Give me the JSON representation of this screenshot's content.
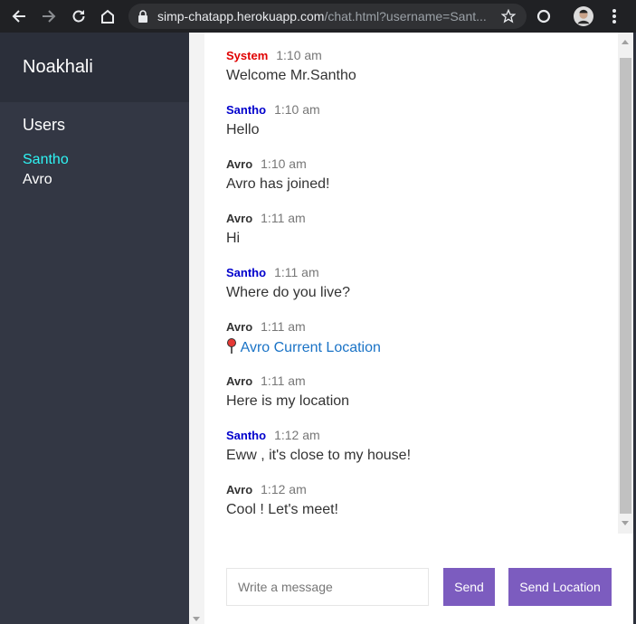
{
  "browser": {
    "url_host": "simp-chatapp.herokuapp.com",
    "url_path": "/chat.html?username=Sant..."
  },
  "sidebar": {
    "room": "Noakhali",
    "users_title": "Users",
    "users": [
      "Santho",
      "Avro"
    ]
  },
  "messages": [
    {
      "author": "System",
      "time": "1:10 am",
      "text": "Welcome Mr.Santho"
    },
    {
      "author": "Santho",
      "time": "1:10 am",
      "text": "Hello"
    },
    {
      "author": "Avro",
      "time": "1:10 am",
      "text": "Avro has joined!"
    },
    {
      "author": "Avro",
      "time": "1:11 am",
      "text": "Hi"
    },
    {
      "author": "Santho",
      "time": "1:11 am",
      "text": "Where do you live?"
    },
    {
      "author": "Avro",
      "time": "1:11 am",
      "link": "Avro Current Location"
    },
    {
      "author": "Avro",
      "time": "1:11 am",
      "text": "Here is my location"
    },
    {
      "author": "Santho",
      "time": "1:12 am",
      "text": "Eww , it's close to my house!"
    },
    {
      "author": "Avro",
      "time": "1:12 am",
      "text": "Cool ! Let's meet!"
    }
  ],
  "composer": {
    "placeholder": "Write a message",
    "send_label": "Send",
    "send_location_label": "Send Location"
  },
  "colors": {
    "sidebar_bg": "#333744",
    "accent": "#7c5cbf",
    "system_author": "#e00000",
    "santho_author": "#0000cc",
    "active_user": "#2ef5f5"
  },
  "icons": [
    "back-arrow-icon",
    "forward-arrow-icon",
    "reload-icon",
    "home-icon",
    "lock-icon",
    "star-icon",
    "circle-extension-icon",
    "profile-avatar",
    "kebab-menu-icon",
    "location-pin-icon"
  ]
}
